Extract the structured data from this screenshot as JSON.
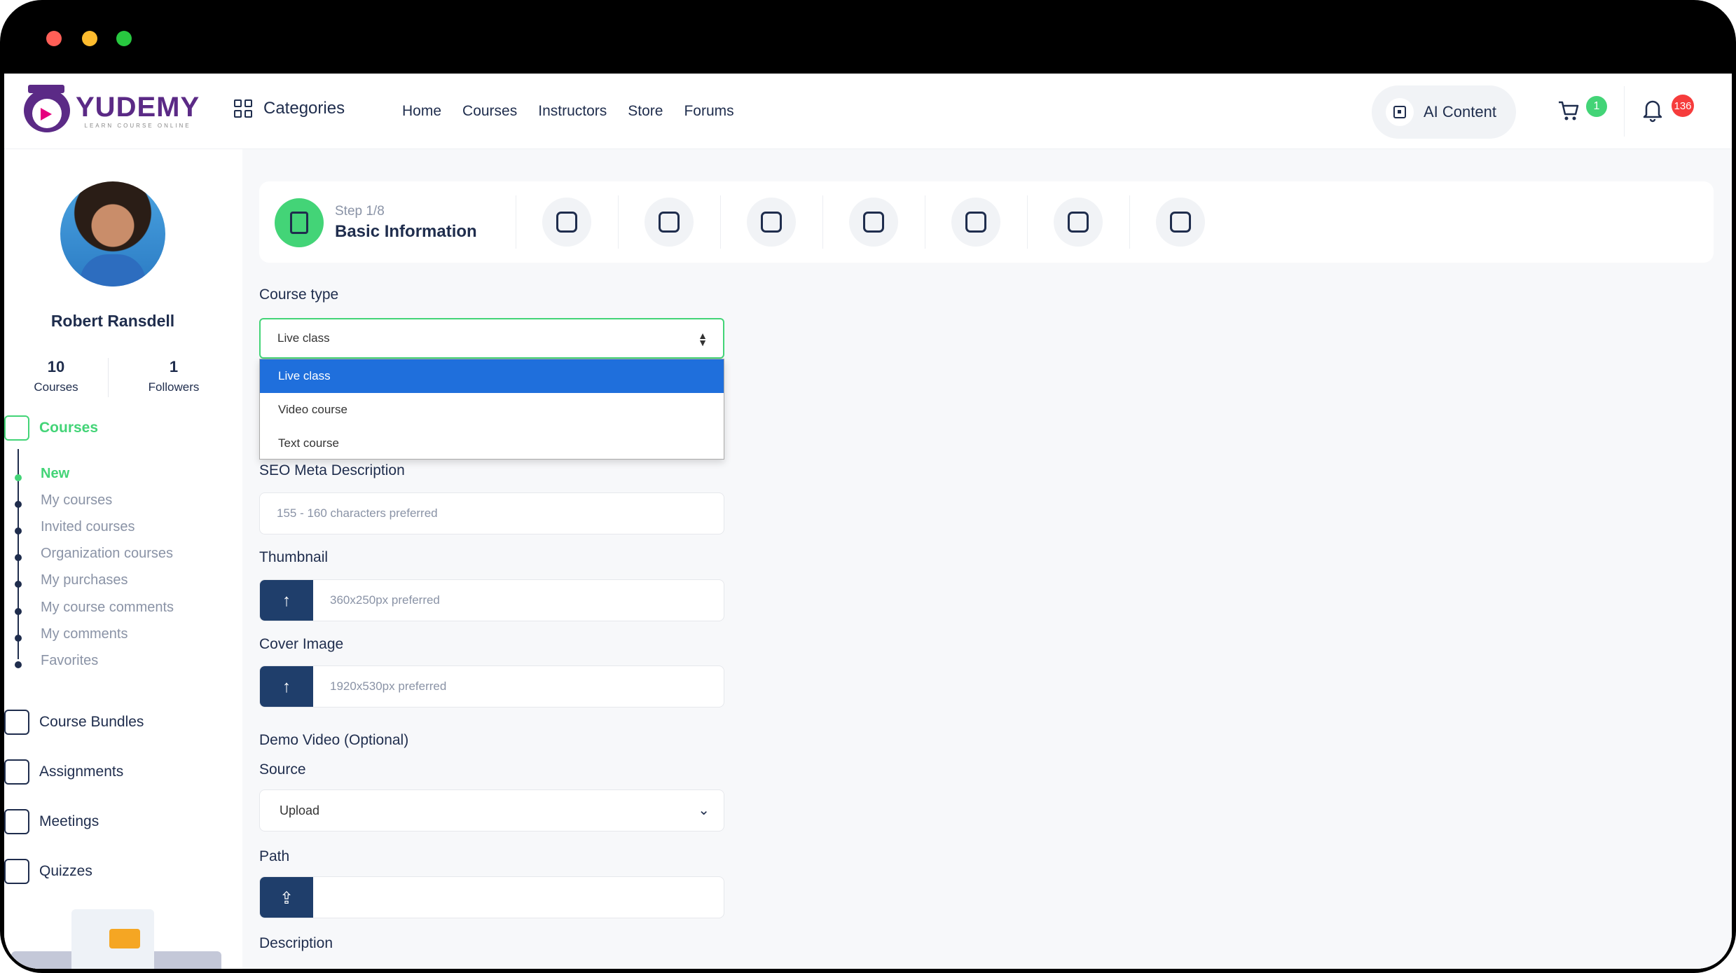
{
  "brand": {
    "name": "YUDEMY",
    "tagline": "LEARN COURSE ONLINE"
  },
  "header": {
    "categories_label": "Categories",
    "nav": [
      "Home",
      "Courses",
      "Instructors",
      "Store",
      "Forums"
    ],
    "ai_button": "AI Content",
    "cart_count": "1",
    "notification_count": "136"
  },
  "sidebar": {
    "user_name": "Robert Ransdell",
    "stats": [
      {
        "value": "10",
        "label": "Courses"
      },
      {
        "value": "1",
        "label": "Followers"
      }
    ],
    "courses_menu": {
      "label": "Courses",
      "items": [
        "New",
        "My courses",
        "Invited courses",
        "Organization courses",
        "My purchases",
        "My course comments",
        "My comments",
        "Favorites"
      ]
    },
    "menu": [
      "Course Bundles",
      "Assignments",
      "Meetings",
      "Quizzes"
    ]
  },
  "stepper": {
    "step_label": "Step 1/8",
    "step_title": "Basic Information"
  },
  "form": {
    "course_type_label": "Course type",
    "course_type_value": "Live class",
    "course_type_options": [
      "Live class",
      "Video course",
      "Text course"
    ],
    "seo_label": "SEO Meta Description",
    "seo_placeholder": "155 - 160 characters preferred",
    "thumbnail_label": "Thumbnail",
    "thumbnail_placeholder": "360x250px preferred",
    "cover_label": "Cover Image",
    "cover_placeholder": "1920x530px preferred",
    "demo_label": "Demo Video (Optional)",
    "source_label": "Source",
    "source_value": "Upload",
    "path_label": "Path",
    "description_label": "Description"
  },
  "colors": {
    "accent": "#43d477",
    "navy": "#1f2d4d",
    "upload": "#1f3e6b",
    "badge_red": "#f63c3c",
    "select_blue": "#1f6fdc"
  }
}
